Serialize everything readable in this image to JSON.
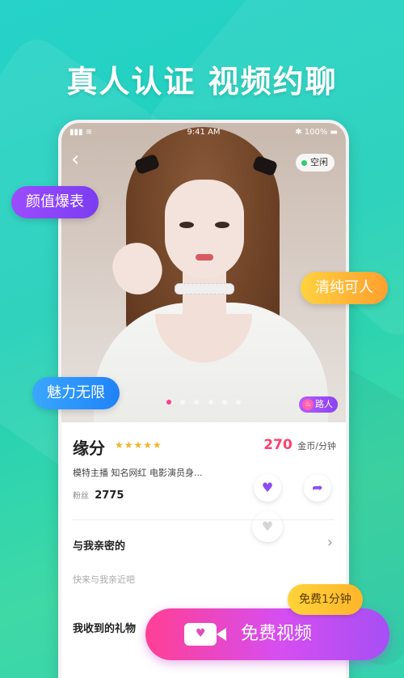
{
  "headline": "真人认证 视频约聊",
  "phone": {
    "status_bar": {
      "time": "9:41 AM",
      "left": "▮▮▮ ≋",
      "right": "✱ 100% ▬"
    },
    "photo": {
      "idle_label": "空闲",
      "tag_label": "路人",
      "dot_count": 6,
      "active_dot": 0
    },
    "profile": {
      "name": "缘分",
      "stars": "★★★★★",
      "price_value": "270",
      "price_unit": "金币/分钟",
      "tags": "模特主播  知名网红  电影演员身...",
      "fans_label": "粉丝",
      "fans_count": "2775"
    },
    "intimacy": {
      "title": "与我亲密的",
      "hint": "快来与我亲近吧"
    },
    "gifts": {
      "title": "我收到的礼物"
    }
  },
  "floating_labels": [
    "颜值爆表",
    "清纯可人",
    "魅力无限"
  ],
  "free_tag": "免费1分钟",
  "video_button": "免费视频",
  "colors": {
    "accent_pink": "#ff3f94",
    "accent_purple": "#a64ff5",
    "bg_teal": "#27d3c9"
  }
}
